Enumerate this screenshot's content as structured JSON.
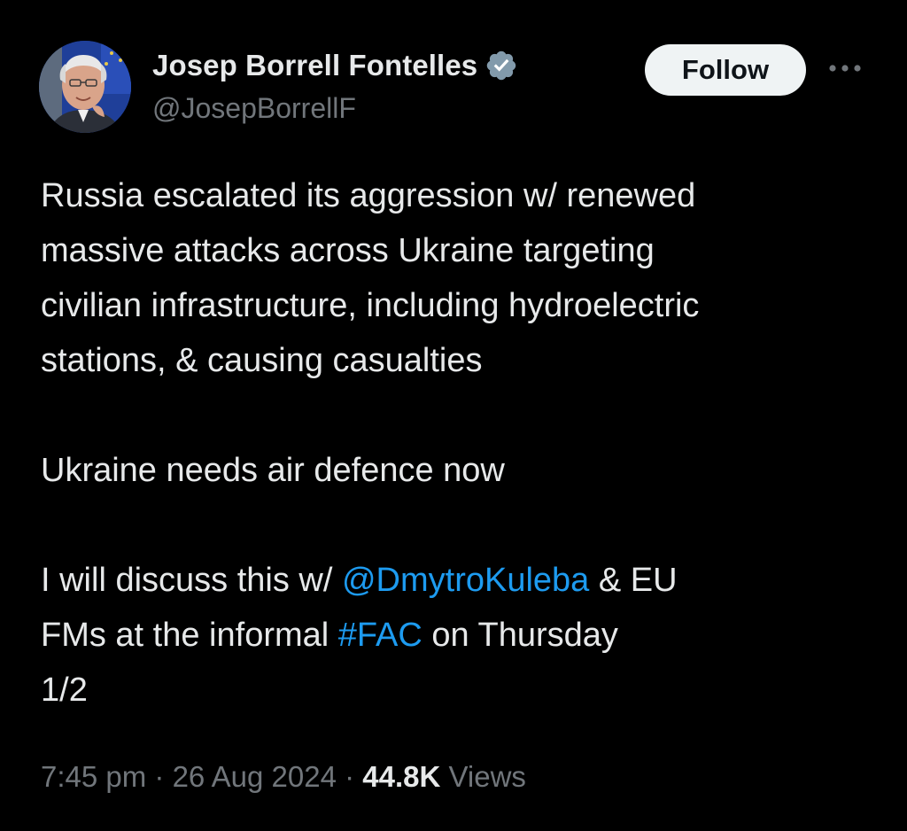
{
  "author": {
    "display_name": "Josep Borrell Fontelles",
    "handle": "@JosepBorrellF",
    "verified": true,
    "verified_badge_color": "#829aab"
  },
  "actions": {
    "follow_label": "Follow",
    "more_icon": "more-horizontal-icon"
  },
  "tweet": {
    "paragraph1": {
      "line1": "Russia escalated its aggression w/ renewed",
      "line2": "massive attacks across Ukraine targeting",
      "line3": "civilian infrastructure, including hydroelectric",
      "line4": "stations, & causing casualties"
    },
    "paragraph2": {
      "line1": "Ukraine needs air defence now"
    },
    "paragraph3": {
      "line1_pre": "I will discuss this w/ ",
      "mention": "@DmytroKuleba",
      "line1_post": " & EU",
      "line2_pre": "FMs at the informal ",
      "hashtag": "#FAC",
      "line2_post": " on Thursday",
      "line3": "1/2"
    }
  },
  "meta": {
    "time": "7:45 pm",
    "separator": " · ",
    "date": "26 Aug 2024",
    "views_count": "44.8K",
    "views_label": " Views"
  },
  "colors": {
    "background": "#000000",
    "text": "#e7e9ea",
    "secondary": "#71767b",
    "link": "#1d9bf0",
    "button_bg": "#eff3f4"
  }
}
